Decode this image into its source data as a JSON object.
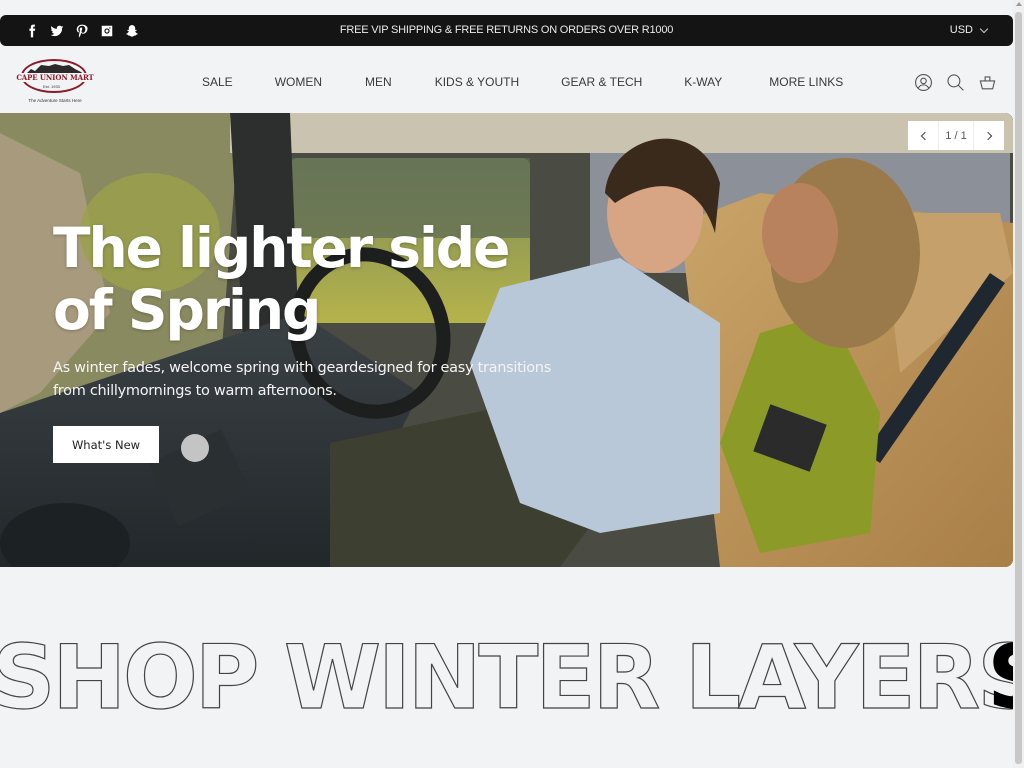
{
  "announcement": {
    "social": [
      {
        "name": "facebook-icon"
      },
      {
        "name": "twitter-icon"
      },
      {
        "name": "pinterest-icon"
      },
      {
        "name": "instagram-icon"
      },
      {
        "name": "snapchat-icon"
      }
    ],
    "text": "FREE VIP SHIPPING &  FREE  RETURNS ON ORDERS OVER  R1000",
    "currency": "USD"
  },
  "header": {
    "logo": {
      "brand": "CAPE UNION MART",
      "established": "Est. 1933",
      "tagline": "The Adventure Starts Here"
    },
    "nav": [
      {
        "label": "SALE"
      },
      {
        "label": "WOMEN"
      },
      {
        "label": "MEN"
      },
      {
        "label": "KIDS & YOUTH"
      },
      {
        "label": "GEAR & TECH"
      },
      {
        "label": "K-WAY"
      },
      {
        "label": "MORE  LINKS"
      }
    ],
    "icons": [
      "account-icon",
      "search-icon",
      "cart-icon"
    ]
  },
  "hero": {
    "title": "The lighter side of Spring",
    "subtitle": "As winter fades, welcome spring with geardesigned for easy transitions from chillymornings to warm afternoons.",
    "button": "What's New",
    "pager": "1 / 1"
  },
  "marquee": {
    "text": "SHOP WINTER LAYERS",
    "next_text": "S"
  }
}
